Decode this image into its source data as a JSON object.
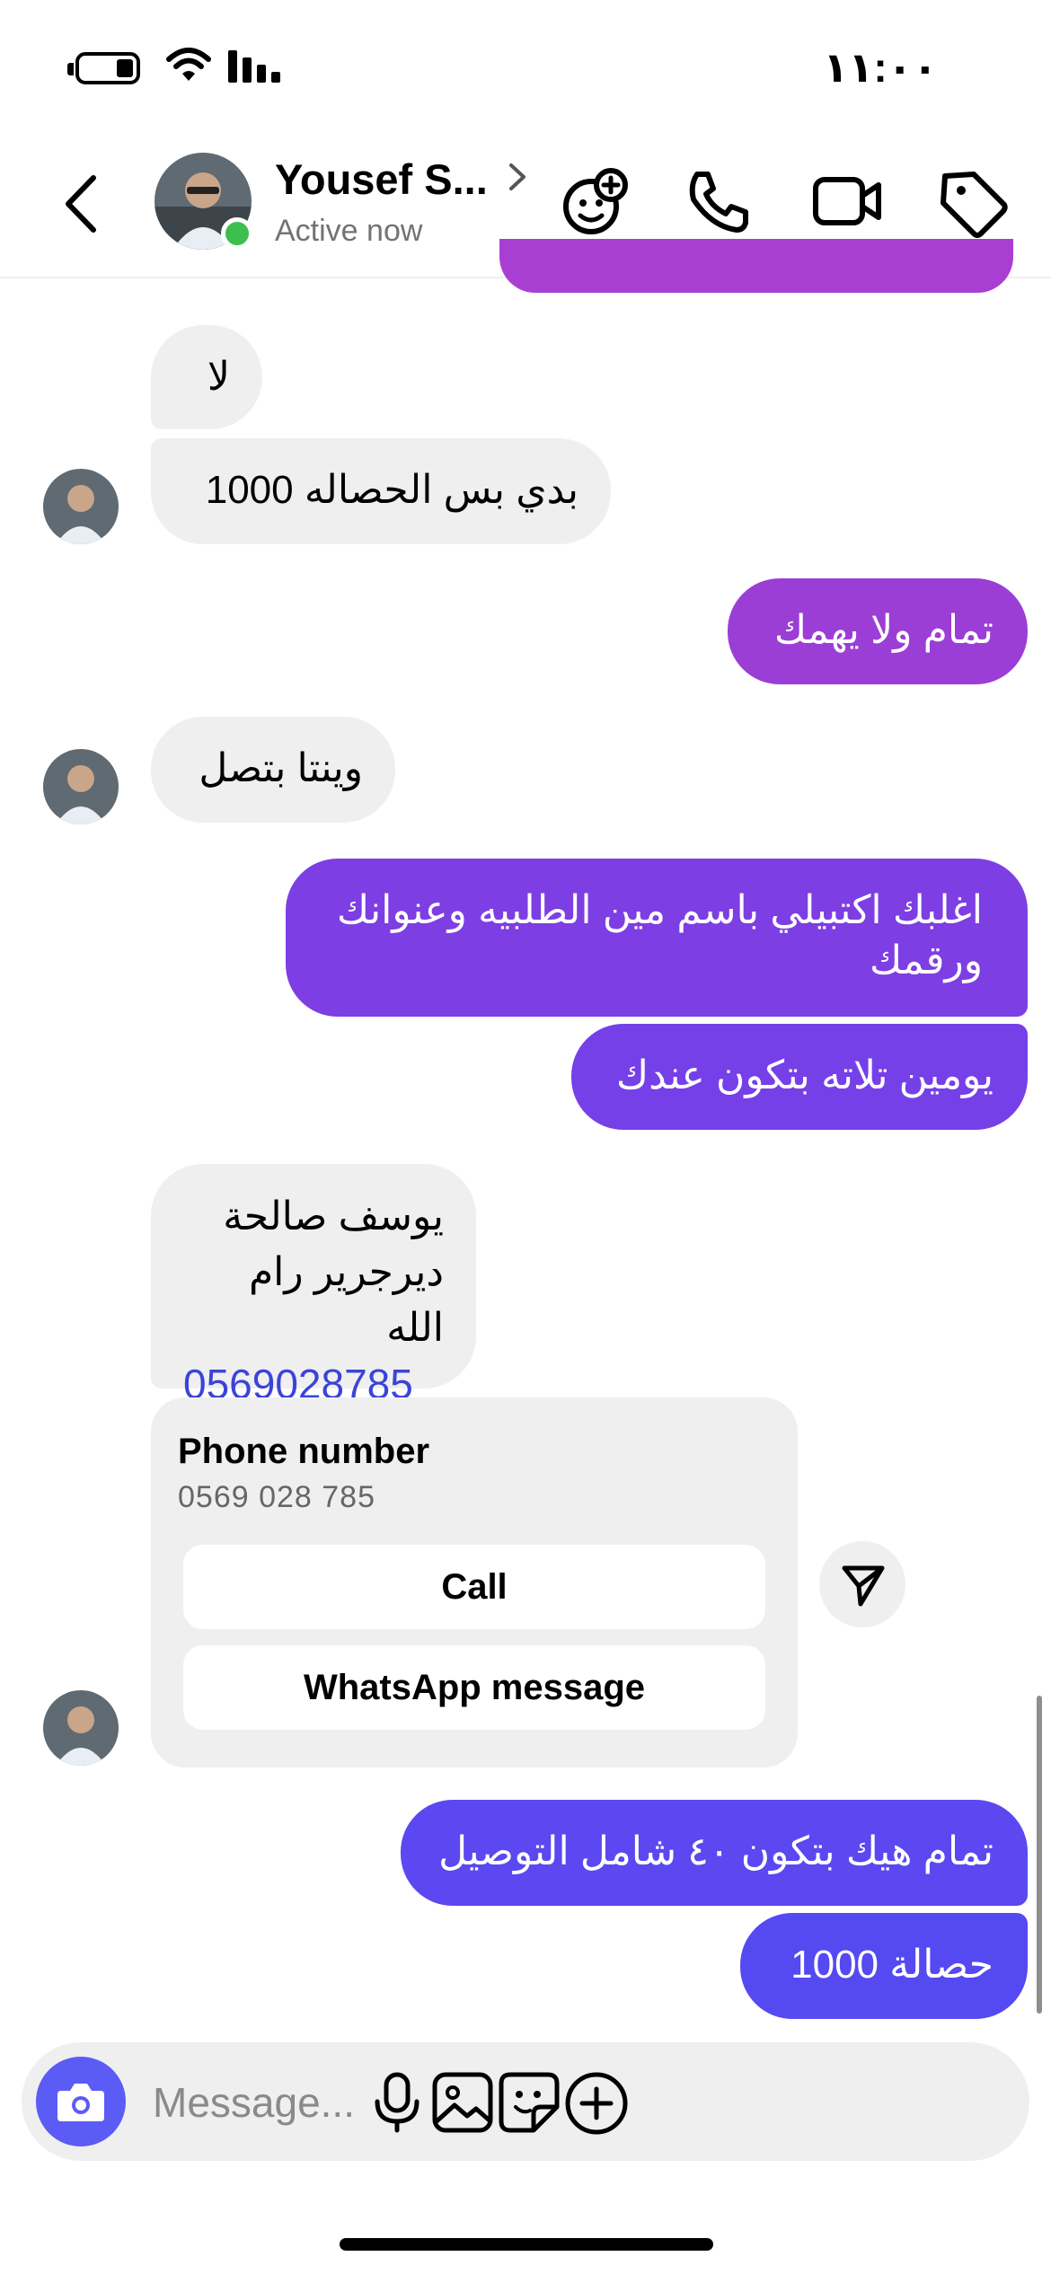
{
  "status_bar": {
    "time": "١١:٠٠"
  },
  "header": {
    "name": "Yousef S...",
    "status": "Active now"
  },
  "messages": [
    {
      "id": "m1",
      "side": "in",
      "text": "لا"
    },
    {
      "id": "m2",
      "side": "in",
      "text": "بدي بس الحصاله 1000"
    },
    {
      "id": "m3",
      "side": "out",
      "text": "تمام ولا يهمك"
    },
    {
      "id": "m4",
      "side": "in",
      "text": "وينتا بتصل"
    },
    {
      "id": "m5",
      "side": "out",
      "text": "اغلبك اكتبيلي باسم مين الطلبيه وعنوانك ورقمك"
    },
    {
      "id": "m6",
      "side": "out",
      "text": "يومين تلاته بتكون عندك"
    },
    {
      "id": "m7",
      "side": "in",
      "line1": "يوسف صالحة",
      "line2": "ديرجرير رام الله",
      "phone_link": "0569028785"
    },
    {
      "id": "m8",
      "side": "out",
      "text": "تمام هيك بتكون ٤٠ شامل التوصيل"
    },
    {
      "id": "m9",
      "side": "out",
      "text": "حصالة 1000"
    }
  ],
  "phone_card": {
    "title": "Phone number",
    "number": "0569 028 785",
    "call_label": "Call",
    "whatsapp_label": "WhatsApp message"
  },
  "composer": {
    "placeholder": "Message..."
  },
  "colors": {
    "online": "#3dbf4f",
    "incoming_bubble": "#efefef",
    "outgoing_purple": "#9b3ed6",
    "outgoing_violet": "#7b3ee6",
    "outgoing_indigo": "#5b48f0",
    "link_blue": "#3a44d9"
  }
}
